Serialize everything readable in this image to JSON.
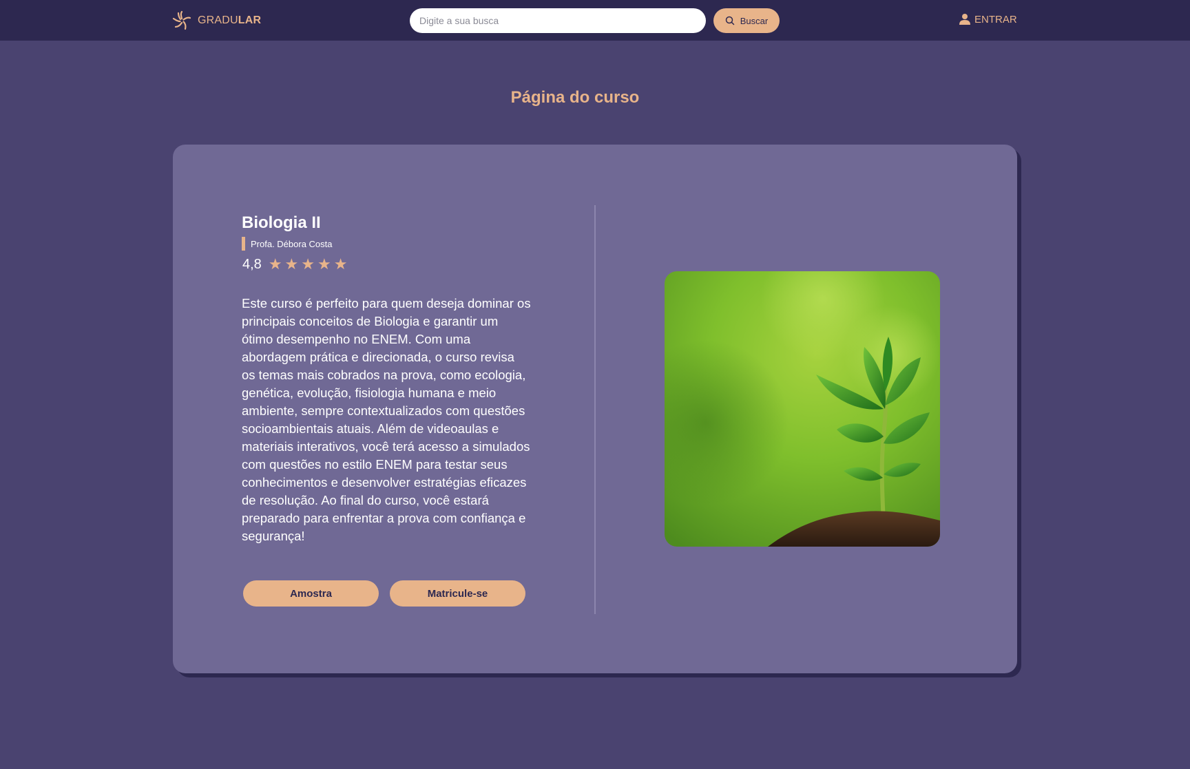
{
  "header": {
    "brand_prefix": "GRADU",
    "brand_suffix": "LAR",
    "search_placeholder": "Digite a sua busca",
    "search_value": "",
    "search_button": "Buscar",
    "login_label": "ENTRAR"
  },
  "page": {
    "title": "Página do curso"
  },
  "course": {
    "title": "Biologia II",
    "teacher": "Profa. Débora Costa",
    "rating": "4,8",
    "stars": 5,
    "description": "Este curso é perfeito para quem deseja dominar os principais conceitos de Biologia e garantir um ótimo desempenho no ENEM. Com uma abordagem prática e direcionada, o curso revisa os temas mais cobrados na prova, como ecologia, genética, evolução, fisiologia humana e meio ambiente, sempre contextualizados com questões socioambientais atuais. Além de videoaulas e materiais interativos, você terá acesso a simulados com questões no estilo ENEM para testar seus conhecimentos e desenvolver estratégias eficazes de resolução. Ao final do curso, você estará preparado para enfrentar a prova com confiança e segurança!",
    "sample_button": "Amostra",
    "enroll_button": "Matricule-se"
  },
  "colors": {
    "background": "#4a4370",
    "topbar": "#2d2850",
    "card": "#706995",
    "accent": "#e8b48a"
  },
  "icons": {
    "logo": "sunburst-logo-icon",
    "search": "search-icon",
    "login": "user-icon",
    "rating": "star-icon",
    "image": "plant-sprout-image"
  }
}
